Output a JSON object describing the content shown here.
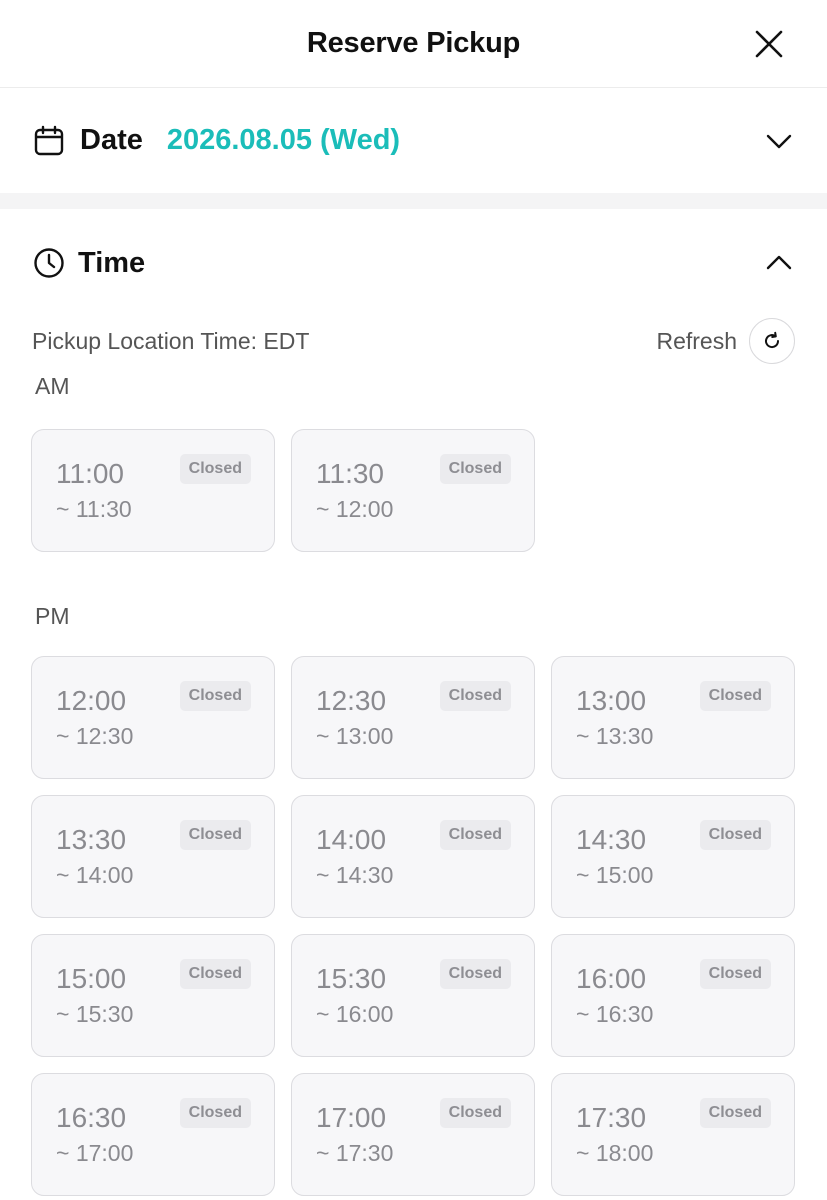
{
  "header": {
    "title": "Reserve Pickup"
  },
  "date": {
    "label": "Date",
    "value": "2026.08.05 (Wed)"
  },
  "time": {
    "label": "Time",
    "timezone_text": "Pickup Location Time: EDT",
    "refresh_label": "Refresh"
  },
  "am": {
    "label": "AM",
    "slots": [
      {
        "start": "11:00",
        "end": "~ 11:30",
        "status": "Closed"
      },
      {
        "start": "11:30",
        "end": "~ 12:00",
        "status": "Closed"
      }
    ]
  },
  "pm": {
    "label": "PM",
    "slots": [
      {
        "start": "12:00",
        "end": "~ 12:30",
        "status": "Closed"
      },
      {
        "start": "12:30",
        "end": "~ 13:00",
        "status": "Closed"
      },
      {
        "start": "13:00",
        "end": "~ 13:30",
        "status": "Closed"
      },
      {
        "start": "13:30",
        "end": "~ 14:00",
        "status": "Closed"
      },
      {
        "start": "14:00",
        "end": "~ 14:30",
        "status": "Closed"
      },
      {
        "start": "14:30",
        "end": "~ 15:00",
        "status": "Closed"
      },
      {
        "start": "15:00",
        "end": "~ 15:30",
        "status": "Closed"
      },
      {
        "start": "15:30",
        "end": "~ 16:00",
        "status": "Closed"
      },
      {
        "start": "16:00",
        "end": "~ 16:30",
        "status": "Closed"
      },
      {
        "start": "16:30",
        "end": "~ 17:00",
        "status": "Closed"
      },
      {
        "start": "17:00",
        "end": "~ 17:30",
        "status": "Closed"
      },
      {
        "start": "17:30",
        "end": "~ 18:00",
        "status": "Closed"
      }
    ]
  },
  "icons": {
    "close": "close-icon",
    "calendar": "calendar-icon",
    "chevron_down": "chevron-down-icon",
    "clock": "clock-icon",
    "chevron_up": "chevron-up-icon",
    "refresh": "refresh-icon"
  },
  "colors": {
    "accent": "#1bbdb9",
    "slot_bg": "#f7f7f9",
    "slot_border": "#dcdce0",
    "badge_bg": "#ebebee"
  }
}
